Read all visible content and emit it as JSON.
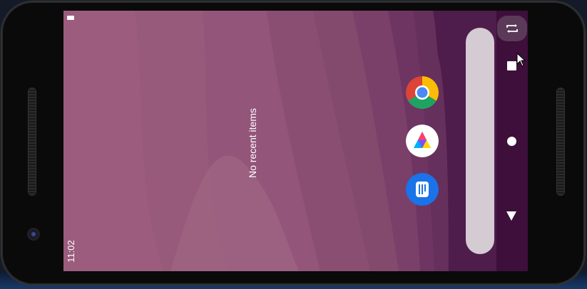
{
  "status_bar": {
    "time": "11:02",
    "battery_icon": "battery-icon"
  },
  "recents": {
    "empty_message": "No recent items"
  },
  "dock": {
    "apps": [
      {
        "icon": "chrome-icon"
      },
      {
        "icon": "play-store-icon"
      },
      {
        "icon": "messages-icon"
      }
    ]
  },
  "nav": {
    "rotate_icon": "rotate-icon",
    "recents_icon": "square-icon",
    "home_icon": "circle-icon",
    "back_icon": "triangle-icon"
  },
  "colors": {
    "wallpaper": "#9b5c7d",
    "nav_bar": "#3e0f3b",
    "search_bar": "#d4cbd3",
    "rotate_button": "#5a3a58"
  }
}
